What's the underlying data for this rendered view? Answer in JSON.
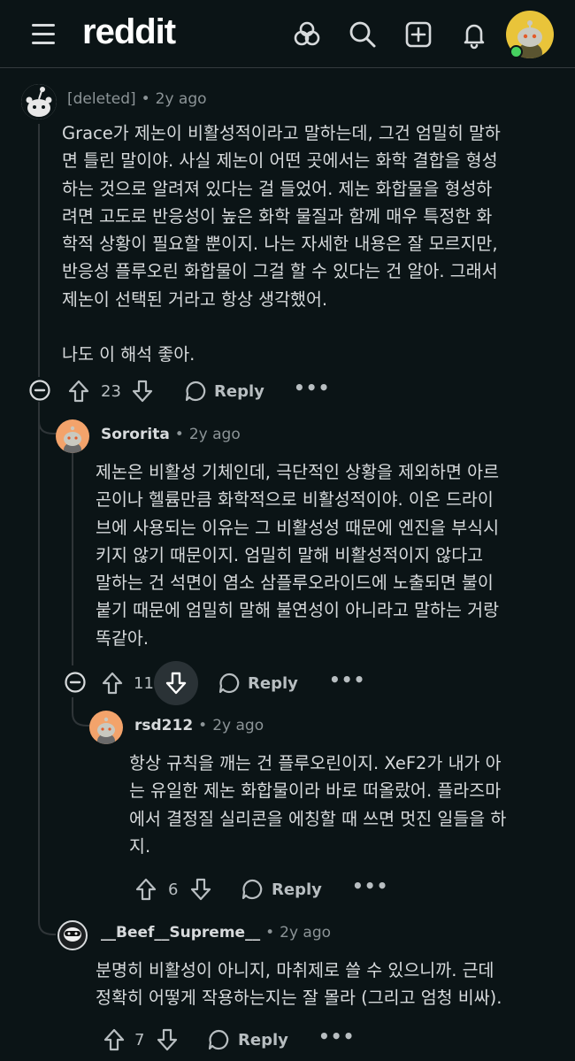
{
  "header": {
    "logo": "reddit",
    "icons": [
      "menu-icon",
      "popular-icon",
      "search-icon",
      "create-post-icon",
      "notifications-icon",
      "user-avatar"
    ]
  },
  "comments": [
    {
      "author": "[deleted]",
      "age": "2y ago",
      "text": "Grace가 제논이 비활성적이라고 말하는데, 그건 엄밀히 말하\n면 틀린 말이야. 사실 제논이 어떤 곳에서는 화학 결합을 형성\n하는 것으로 알려져 있다는 걸 들었어. 제논 화합물을 형성하\n려면 고도로 반응성이 높은 화학 물질과 함께 매우 특정한 화\n학적 상황이 필요할 뿐이지. 나는 자세한 내용은 잘 모르지만,\n반응성 플루오린 화합물이 그걸 할 수 있다는 건 알아. 그래서\n제논이 선택된 거라고 항상 생각했어.\n\n나도 이 해석 좋아.",
      "votes": "23",
      "reply": "Reply",
      "more": "•••"
    },
    {
      "author": "Sororita",
      "age": "2y ago",
      "text": "제논은 비활성 기체인데, 극단적인 상황을 제외하면 아르\n곤이나 헬륨만큼 화학적으로 비활성적이야. 이온 드라이\n브에 사용되는 이유는 그 비활성성 때문에 엔진을 부식시\n키지 않기 때문이지. 엄밀히 말해 비활성적이지 않다고\n말하는 건 석면이 염소 삼플루오라이드에 노출되면 불이\n붙기 때문에 엄밀히 말해 불연성이 아니라고 말하는 거랑\n똑같아.",
      "votes": "11",
      "reply": "Reply",
      "more": "•••"
    },
    {
      "author": "rsd212",
      "age": "2y ago",
      "text": "항상 규칙을 깨는 건 플루오린이지. XeF2가 내가 아\n는 유일한 제논 화합물이라 바로 떠올랐어. 플라즈마\n에서 결정질 실리콘을 에칭할 때 쓰면 멋진 일들을 하\n지.",
      "votes": "6",
      "reply": "Reply",
      "more": "•••"
    },
    {
      "author": "__Beef__Supreme__",
      "age": "2y ago",
      "text": "분명히 비활성이 아니지, 마취제로 쓸 수 있으니까. 근데\n정확히 어떻게 작용하는지는 잘 몰라 (그리고 엄청 비싸).",
      "votes": "7",
      "reply": "Reply",
      "more": "•••"
    }
  ],
  "colors": {
    "background": "#0b1416",
    "text": "#d7dadc",
    "muted": "#8c9497",
    "thread": "#2f3538",
    "avatar_orange": "#f3a36b",
    "avatar_yellow": "#e9c43a"
  }
}
